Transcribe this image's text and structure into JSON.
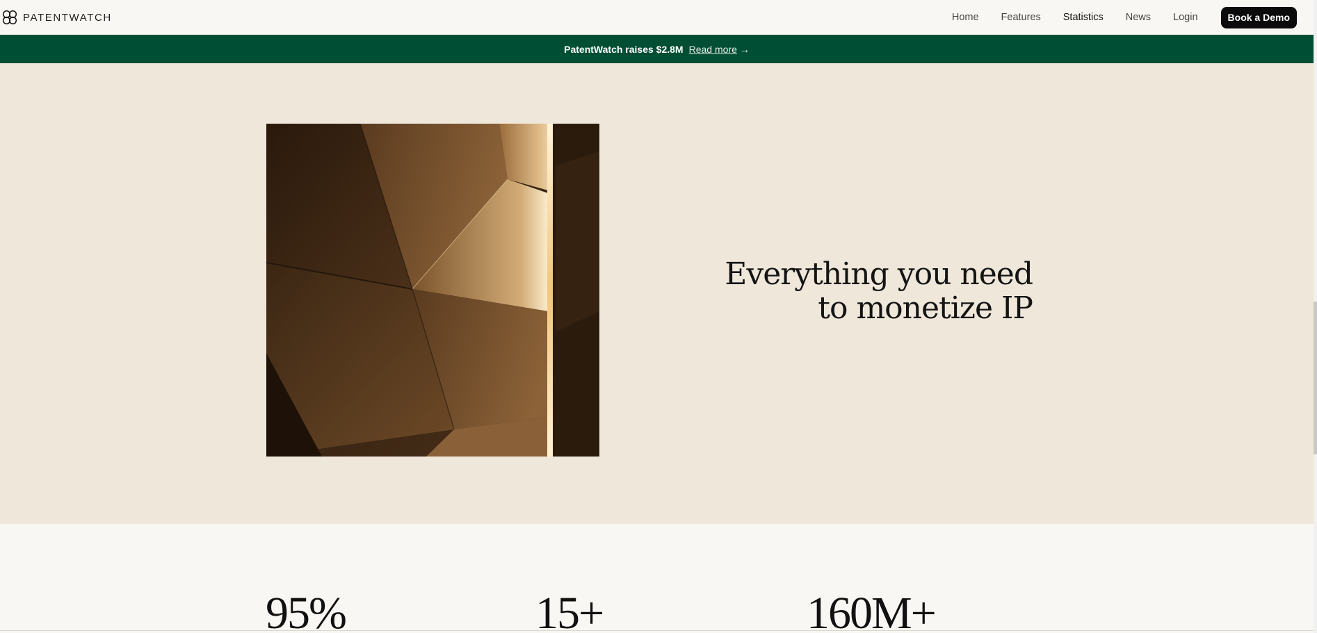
{
  "nav": {
    "brand_name": "PATENTWATCH",
    "brand_icon": "quatrefoil-logo-icon",
    "links": [
      {
        "label": "Home",
        "active": false
      },
      {
        "label": "Features",
        "active": false
      },
      {
        "label": "Statistics",
        "active": true
      },
      {
        "label": "News",
        "active": false
      },
      {
        "label": "Login",
        "active": false
      }
    ],
    "cta_label": "Book a Demo"
  },
  "announcement": {
    "text": "PatentWatch raises $2.8M",
    "link_label": "Read more",
    "arrow": "→",
    "background": "#004e33"
  },
  "hero": {
    "title_line1": "Everything you need",
    "title_line2": "to monetize IP",
    "background": "#efe7da",
    "image": "abstract-bronze-folded-panels"
  },
  "stats": [
    {
      "value": "95%"
    },
    {
      "value": "15+"
    },
    {
      "value": "160M+"
    }
  ]
}
